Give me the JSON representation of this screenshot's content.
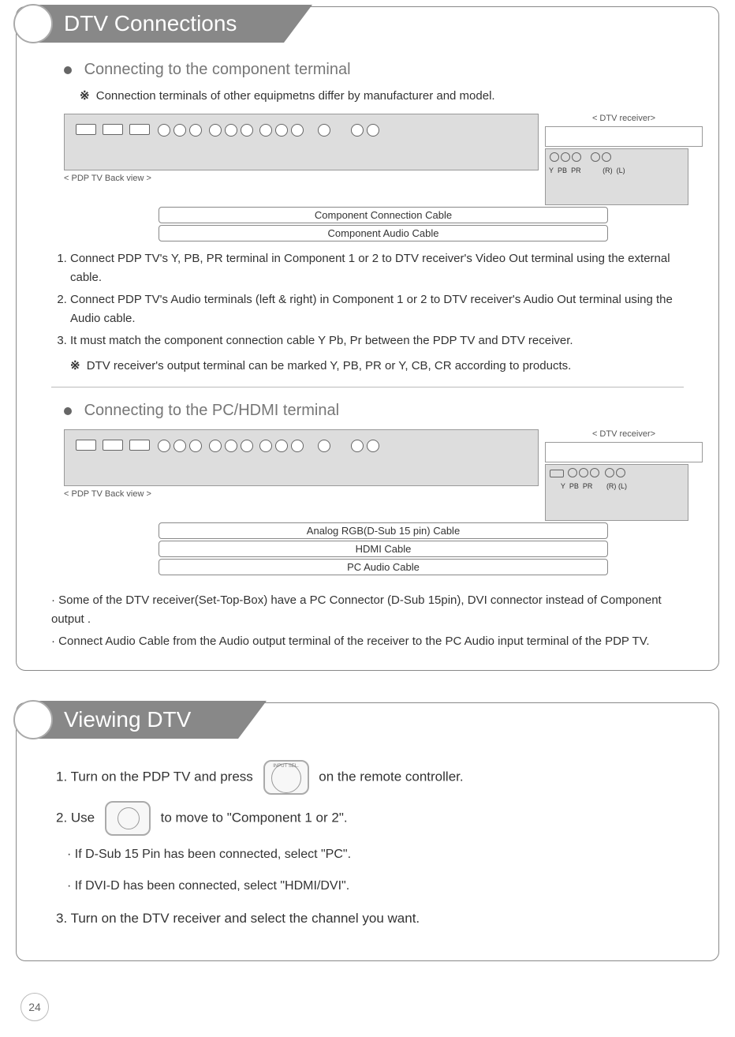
{
  "sections": {
    "dtv_conn": {
      "title": "DTV Connections",
      "sub1": "Connecting to the component terminal",
      "note1": "Connection terminals of other equipmetns differ by manufacturer and model.",
      "pdp_label": "< PDP TV Back view >",
      "recv_label": "< DTV receiver>",
      "cable1": "Component Connection Cable",
      "cable2": "Component Audio Cable",
      "steps_a": [
        "Connect PDP TV's Y, PB, PR terminal in Component 1 or 2 to DTV receiver's Video Out terminal using the external cable.",
        "Connect PDP TV's Audio terminals (left & right) in Component 1 or 2 to DTV receiver's Audio Out terminal using the Audio cable.",
        "It must match the component connection cable Y Pb, Pr between the PDP TV and DTV receiver."
      ],
      "steps_a_note": "DTV receiver's output terminal can be marked Y, PB, PR or Y, CB, CR according to products.",
      "sub2": "Connecting to the PC/HDMI terminal",
      "cable3": "Analog RGB(D-Sub 15 pin) Cable",
      "cable4": "HDMI Cable",
      "cable5": "PC Audio Cable",
      "bullets_b": [
        "Some of the DTV receiver(Set-Top-Box) have a PC Connector (D-Sub 15pin), DVI connector instead of Component output .",
        "Connect Audio Cable from the Audio output terminal of the receiver to the PC Audio input terminal of the PDP TV."
      ],
      "port_labels": {
        "y": "Y",
        "pb": "PB",
        "pr": "PR",
        "r": "(R)",
        "l": "(L)"
      }
    },
    "viewing": {
      "title": "Viewing DTV",
      "line1a": "1. Turn on the PDP TV and press",
      "line1b": "on the remote controller.",
      "line2a": "2. Use",
      "line2b": "to move to \"Component 1 or 2\".",
      "input_sel": "INPUT SEL.",
      "sub_lines": [
        "If D-Sub 15 Pin has been connected, select \"PC\".",
        "If DVI-D has been connected, select \"HDMI/DVI\"."
      ],
      "line3": "3. Turn on the DTV receiver and select the channel you want."
    }
  },
  "page_number": "24"
}
